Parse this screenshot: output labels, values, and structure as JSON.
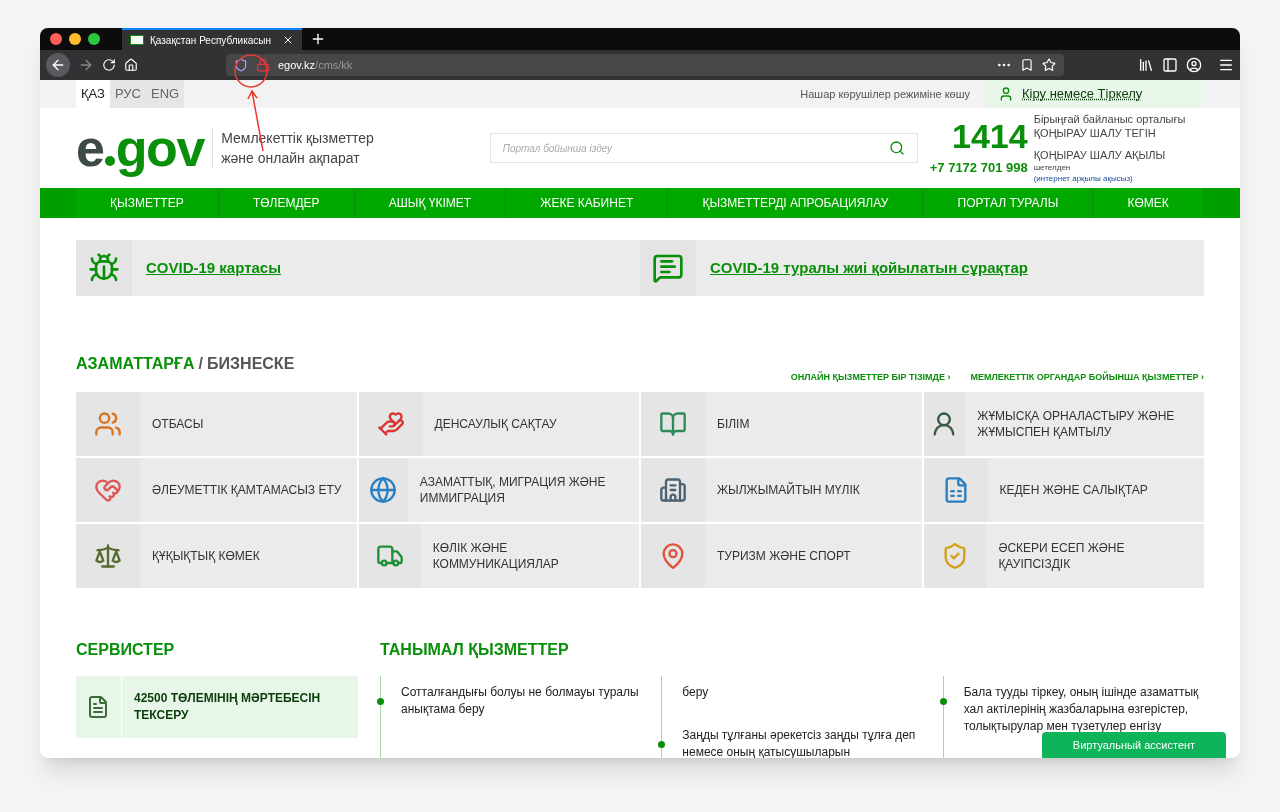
{
  "browser": {
    "tab_title": "Қазақстан Республикасын",
    "url_host": "egov.kz",
    "url_path": "/cms/kk"
  },
  "topbar": {
    "languages": [
      {
        "label": "ҚАЗ",
        "selected": true
      },
      {
        "label": "РУС",
        "selected": false
      },
      {
        "label": "ENG",
        "selected": false
      }
    ],
    "accessibility_link": "Нашар көрушілер режиміне көшу",
    "login": "Кіру немесе Тіркелу"
  },
  "header": {
    "logo_e": "e",
    "logo_gov": "gov",
    "tagline": [
      "Мемлекеттік қызметтер",
      "және онлайн ақпарат"
    ],
    "search": {
      "placeholder": "Портал бойынша іздеу"
    },
    "hotline": "1414",
    "hotline_lines": [
      "Бірыңғай байланыс орталығы",
      "ҚОҢЫРАУ ШАЛУ ТЕГІН"
    ],
    "phone": "+7 7172 701 998",
    "phone_label": "ҚОҢЫРАУ ШАЛУ АҚЫЛЫ",
    "phone_note": "шетелден",
    "phone_note_link": "(интернет арқылы ақысыз)"
  },
  "nav": [
    "ҚЫЗМЕТТЕР",
    "ТӨЛЕМДЕР",
    "АШЫҚ ҮКІМЕТ",
    "ЖЕКЕ КАБИНЕТ",
    "ҚЫЗМЕТТЕРДІ АПРОБАЦИЯЛАУ",
    "ПОРТАЛ ТУРАЛЫ",
    "КӨМЕК"
  ],
  "covid": [
    {
      "kind": "virus",
      "label": "COVID-19 картасы"
    },
    {
      "kind": "faq",
      "label": "COVID-19 туралы жиі қойылатын сұрақтар"
    }
  ],
  "audience_tabs": [
    {
      "label": "АЗАМАТТАРҒА",
      "selected": true
    },
    {
      "label": "БИЗНЕСКЕ",
      "selected": false
    }
  ],
  "audience_separator": "/",
  "section_links": [
    "ОНЛАЙН ҚЫЗМЕТТЕР БІР ТІЗІМДЕ ›",
    "МЕМЛЕКЕТТІК ОРГАНДАР БОЙЫНША ҚЫЗМЕТТЕР ›"
  ],
  "categories": [
    {
      "kind": "family",
      "label": "ОТБАСЫ"
    },
    {
      "kind": "health",
      "label": "ДЕНСАУЛЫҚ САҚТАУ"
    },
    {
      "kind": "books",
      "label": "БІЛІМ"
    },
    {
      "kind": "worker",
      "label": "ЖҰМЫСҚА ОРНАЛАСТЫРУ ЖӘНЕ ЖҰМЫСПЕН ҚАМТЫЛУ"
    },
    {
      "kind": "care",
      "label": "ӘЛЕУМЕТТІК ҚАМТАМАСЫЗ ЕТУ"
    },
    {
      "kind": "globe-people",
      "label": "АЗАМАТТЫҚ, МИГРАЦИЯ ЖӘНЕ ИММИГРАЦИЯ"
    },
    {
      "kind": "building",
      "label": "ЖЫЛЖЫМАЙТЫН МҮЛІК"
    },
    {
      "kind": "document",
      "label": "КЕДЕН ЖӘНЕ САЛЫҚТАР"
    },
    {
      "kind": "scales",
      "label": "ҚҰҚЫҚТЫҚ КӨМЕК"
    },
    {
      "kind": "truck",
      "label": "КӨЛІК ЖӘНЕ КОММУНИКАЦИЯЛАР"
    },
    {
      "kind": "globe-pins",
      "label": "ТУРИЗМ ЖӘНЕ СПОРТ"
    },
    {
      "kind": "shield",
      "label": "ӘСКЕРИ ЕСЕП ЖӘНЕ ҚАУІПСІЗДІК"
    }
  ],
  "services": {
    "title": "СЕРВИСТЕР",
    "items": [
      "42500 ТӨЛЕМІНІҢ МӘРТЕБЕСІН ТЕКСЕРУ"
    ]
  },
  "popular": {
    "title": "ТАНЫМАЛ ҚЫЗМЕТТЕР",
    "columns": [
      [
        {
          "text": "Сотталғандығы болуы не болмауы туралы анықтама беру",
          "dot": true
        }
      ],
      [
        {
          "text": "беру",
          "dot": false
        },
        {
          "text": "Заңды тұлғаны әрекетсіз заңды тұлға деп немесе оның қатысушыларын",
          "dot": true
        }
      ],
      [
        {
          "text": "Бала тууды тіркеу, оның ішінде азаматтық хал актілерінің жазбаларына өзгерістер, толықтырулар мен түзетулер енгізу",
          "dot": true
        }
      ]
    ]
  },
  "assistant_button": "Виртуальный ассистент"
}
